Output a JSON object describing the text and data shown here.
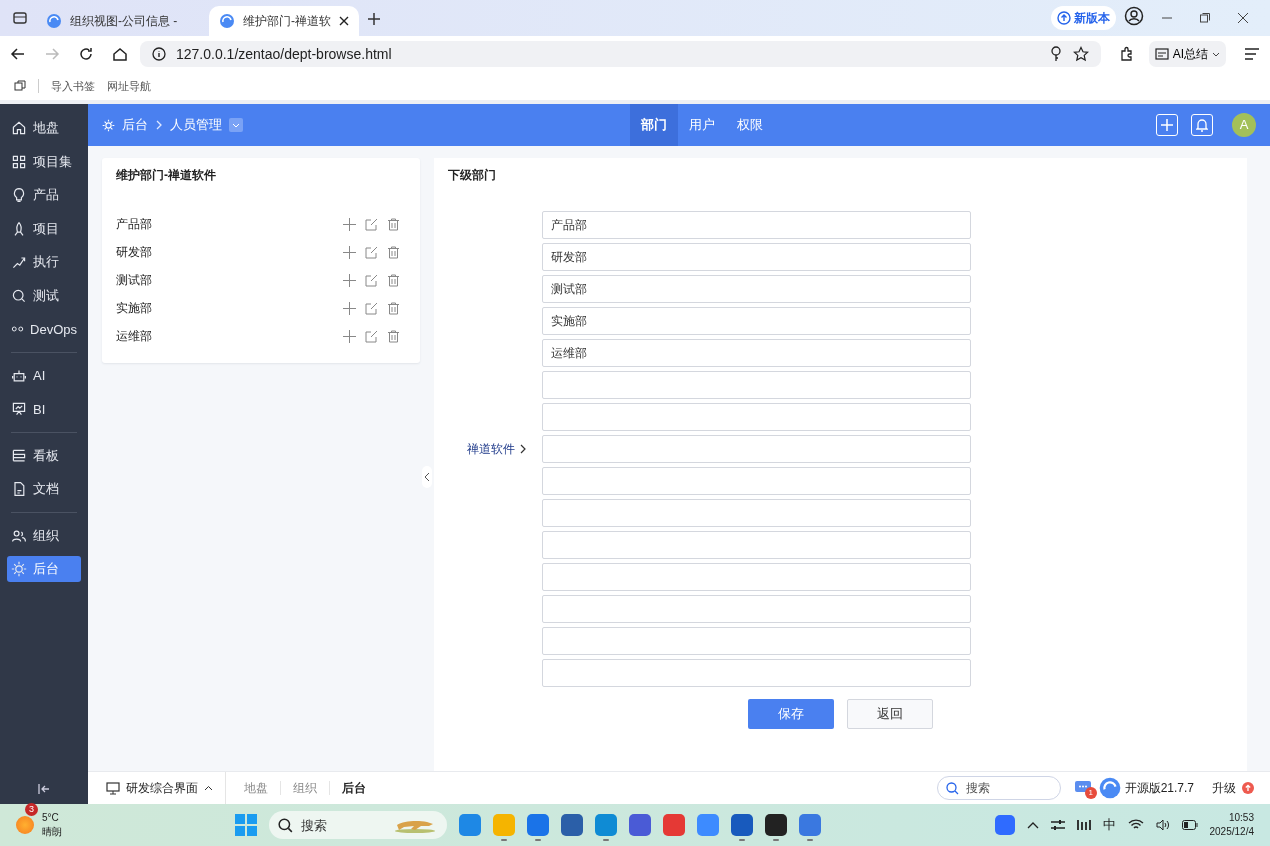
{
  "browser": {
    "tabs": [
      {
        "title": "组织视图-公司信息 -",
        "selected": false
      },
      {
        "title": "维护部门-禅道软",
        "selected": true
      }
    ],
    "url": "127.0.0.1/zentao/dept-browse.html",
    "new_version": "新版本",
    "ai_summary": "AI总结",
    "bookmarks": [
      "导入书签",
      "网址导航"
    ]
  },
  "sidebar": {
    "groups": [
      [
        {
          "label": "地盘",
          "selected": false
        },
        {
          "label": "项目集",
          "selected": false
        },
        {
          "label": "产品",
          "selected": false
        },
        {
          "label": "项目",
          "selected": false
        },
        {
          "label": "执行",
          "selected": false
        },
        {
          "label": "测试",
          "selected": false
        },
        {
          "label": "DevOps",
          "selected": false
        }
      ],
      [
        {
          "label": "AI",
          "selected": false
        },
        {
          "label": "BI",
          "selected": false
        }
      ],
      [
        {
          "label": "看板",
          "selected": false
        },
        {
          "label": "文档",
          "selected": false
        }
      ],
      [
        {
          "label": "组织",
          "selected": false
        },
        {
          "label": "后台",
          "selected": true
        }
      ]
    ]
  },
  "header": {
    "breadcrumb": [
      "后台",
      "人员管理"
    ],
    "nav": [
      {
        "label": "部门",
        "selected": true
      },
      {
        "label": "用户",
        "selected": false
      },
      {
        "label": "权限",
        "selected": false
      }
    ],
    "avatar": "A"
  },
  "left_panel": {
    "title": "维护部门-禅道软件",
    "departments": [
      "产品部",
      "研发部",
      "测试部",
      "实施部",
      "运维部"
    ]
  },
  "right_panel": {
    "title": "下级部门",
    "parent": "禅道软件",
    "fields": [
      {
        "kind": "filled",
        "value": "产品部"
      },
      {
        "kind": "filled",
        "value": "研发部"
      },
      {
        "kind": "filled",
        "value": "测试部"
      },
      {
        "kind": "filled",
        "value": "实施部"
      },
      {
        "kind": "filled",
        "value": "运维部"
      },
      {
        "kind": "empty"
      },
      {
        "kind": "empty"
      },
      {
        "kind": "empty"
      },
      {
        "kind": "empty"
      },
      {
        "kind": "empty"
      },
      {
        "kind": "empty"
      },
      {
        "kind": "empty"
      },
      {
        "kind": "empty"
      },
      {
        "kind": "empty"
      },
      {
        "kind": "empty"
      }
    ],
    "buttons": [
      {
        "kind": "primary",
        "label": "保存"
      },
      {
        "kind": "default",
        "label": "返回"
      }
    ]
  },
  "bottom_bar": {
    "menu": "研发综合界面",
    "crumbs": [
      {
        "label": "地盘",
        "selected": false
      },
      {
        "label": "组织",
        "selected": false
      },
      {
        "label": "后台",
        "selected": true
      }
    ],
    "search_placeholder": "搜索",
    "message_count": "1",
    "version": "开源版21.7.7",
    "upgrade": "升级"
  },
  "taskbar": {
    "weather_badge": "3",
    "temperature": "5°C",
    "condition": "晴朗",
    "search_placeholder": "搜索",
    "apps": [
      {
        "color": "#1e88e5",
        "running": false
      },
      {
        "color": "#f5b400",
        "running": true
      },
      {
        "color": "#1a73e8",
        "running": true
      },
      {
        "color": "#2b5fa8",
        "running": false
      },
      {
        "color": "#0f8bd4",
        "running": true
      },
      {
        "color": "#4a5bd6",
        "running": false
      },
      {
        "color": "#e53935",
        "running": false
      },
      {
        "color": "#3d8bff",
        "running": false
      },
      {
        "color": "#185abd",
        "running": true
      },
      {
        "color": "#222222",
        "running": true
      },
      {
        "color": "#3a78e0",
        "running": true
      }
    ],
    "ime": "中",
    "time": "10:53",
    "date": "2025/12/4"
  }
}
